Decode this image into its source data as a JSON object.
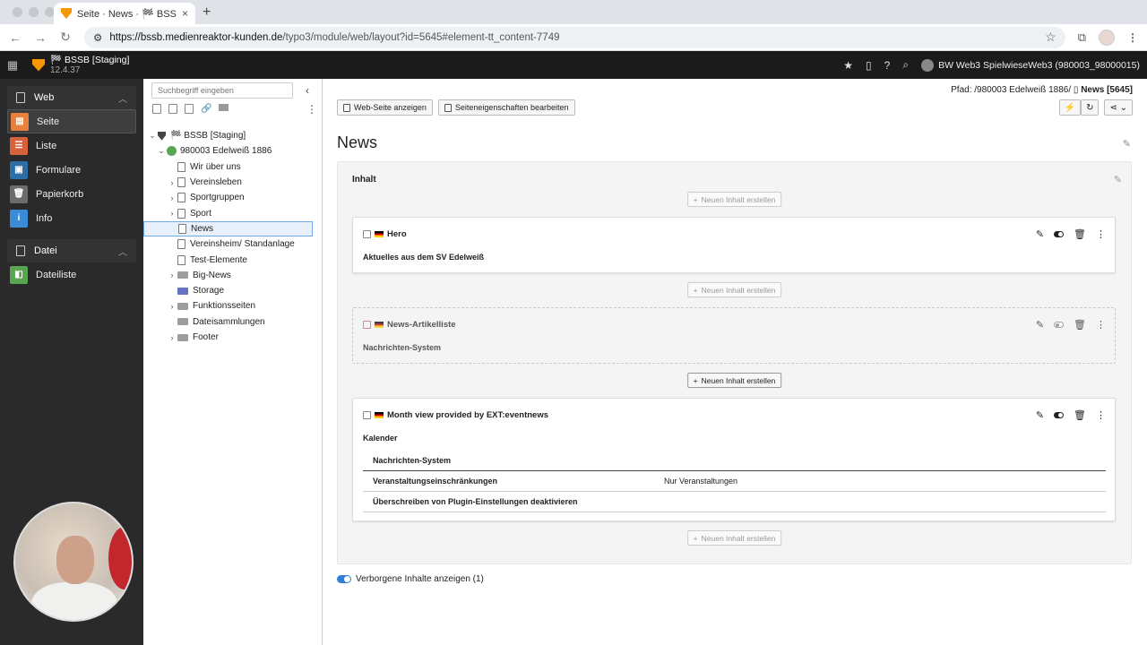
{
  "browser": {
    "tab_title": "Seite · News · 🏁 BSSB [Stag",
    "tab_close": "×",
    "new_tab": "+",
    "url_domain": "https://bssb.medienreaktor-kunden.de",
    "url_path": "/typo3/module/web/layout?id=5645#element-tt_content-7749"
  },
  "topbar": {
    "site_name": "🏁 BSSB [Staging]",
    "version": "12.4.37",
    "user": "BW Web3 SpielwieseWeb3 (980003_98000015)"
  },
  "modules": {
    "web_group": "Web",
    "items": [
      {
        "label": "Seite",
        "color": "#e8813d"
      },
      {
        "label": "Liste",
        "color": "#d6613b"
      },
      {
        "label": "Formulare",
        "color": "#2d6ea8"
      },
      {
        "label": "Papierkorb",
        "color": "#6c6c6c"
      },
      {
        "label": "Info",
        "color": "#3c8bd6"
      }
    ],
    "file_group": "Datei",
    "file_items": [
      {
        "label": "Dateiliste",
        "color": "#5aa552"
      }
    ]
  },
  "tree": {
    "search_placeholder": "Suchbegriff eingeben",
    "root": "🏁 BSSB [Staging]",
    "site": "980003 Edelweiß 1886",
    "nodes": [
      {
        "label": "Wir über uns"
      },
      {
        "label": "Vereinsleben"
      },
      {
        "label": "Sportgruppen"
      },
      {
        "label": "Sport"
      },
      {
        "label": "News"
      },
      {
        "label": "Vereinsheim/ Standanlage"
      },
      {
        "label": "Test-Elemente"
      },
      {
        "label": "Big-News"
      },
      {
        "label": "Storage"
      },
      {
        "label": "Funktionsseiten"
      },
      {
        "label": "Dateisammlungen"
      },
      {
        "label": "Footer"
      }
    ]
  },
  "content": {
    "path_label": "Pfad: /980003 Edelweiß 1886/",
    "path_current": "News [5645]",
    "btn_view": "Web-Seite anzeigen",
    "btn_props": "Seiteneigenschaften bearbeiten",
    "title": "News",
    "column_title": "Inhalt",
    "new_content": "Neuen Inhalt erstellen",
    "cards": [
      {
        "title": "Hero",
        "subtitle": "Aktuelles aus dem SV Edelweiß"
      },
      {
        "title": "News-Artikelliste",
        "subtitle": "Nachrichten-System"
      },
      {
        "title": "Month view provided by EXT:eventnews",
        "subtitle": "Kalender"
      }
    ],
    "props": [
      {
        "key": "Nachrichten-System",
        "value": ""
      },
      {
        "key": "Veranstaltungseinschränkungen",
        "value": "Nur Veranstaltungen"
      },
      {
        "key": "Überschreiben von Plugin-Einstellungen deaktivieren",
        "value": ""
      }
    ],
    "hidden_toggle": "Verborgene Inhalte anzeigen (1)"
  }
}
